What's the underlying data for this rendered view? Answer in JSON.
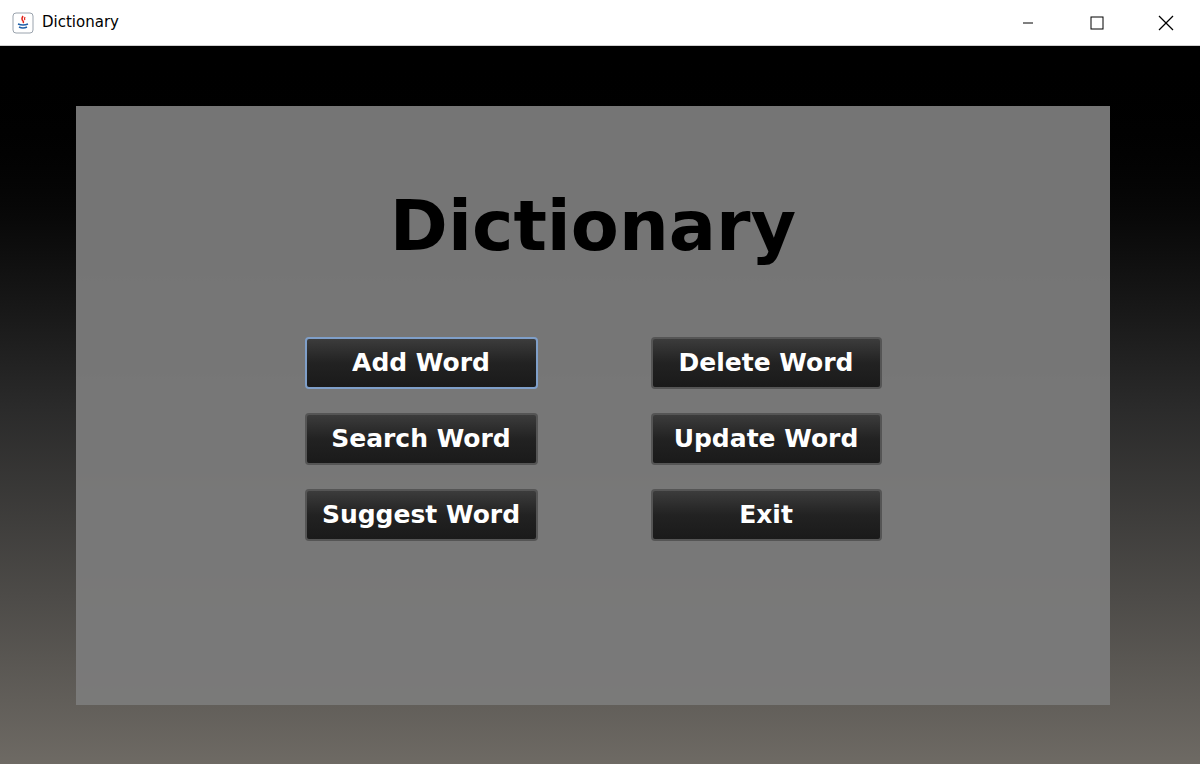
{
  "window": {
    "title": "Dictionary"
  },
  "heading": "Dictionary",
  "buttons": [
    {
      "label": "Add Word",
      "focused": true
    },
    {
      "label": "Delete Word",
      "focused": false
    },
    {
      "label": "Search Word",
      "focused": false
    },
    {
      "label": "Update Word",
      "focused": false
    },
    {
      "label": "Suggest Word",
      "focused": false
    },
    {
      "label": "Exit",
      "focused": false
    }
  ]
}
